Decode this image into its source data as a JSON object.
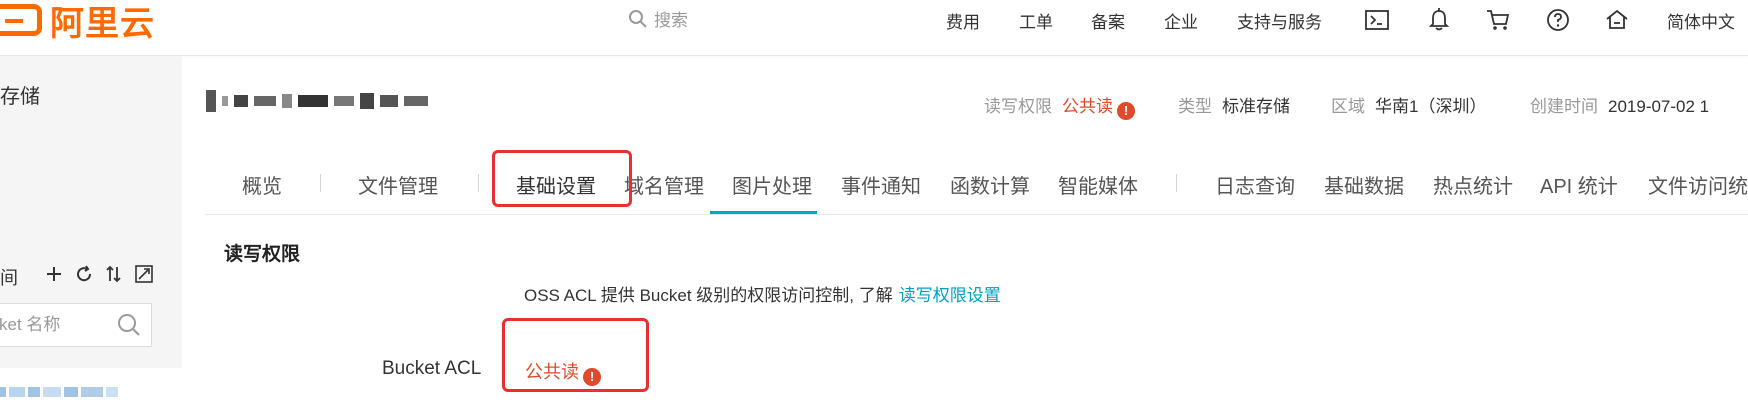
{
  "brand": {
    "logo_text": "阿里云",
    "color": "#ff6a00"
  },
  "search": {
    "placeholder": "搜索"
  },
  "topnav": {
    "fees": "费用",
    "tickets": "工单",
    "filing": "备案",
    "enterprise": "企业",
    "support": "支持与服务",
    "language": "简体中文",
    "icons": [
      "terminal-icon",
      "bell-icon",
      "cart-icon",
      "help-icon",
      "home-icon"
    ]
  },
  "sidebar": {
    "title": "存储",
    "list_label": "间",
    "search_placeholder": "ket 名称",
    "tool_icons": [
      "add-icon",
      "refresh-icon",
      "sort-icon",
      "expand-icon"
    ]
  },
  "bucket_meta": {
    "acl_label": "读写权限",
    "acl_value": "公共读",
    "type_label": "类型",
    "type_value": "标准存储",
    "region_label": "区域",
    "region_value": "华南1（深圳）",
    "created_label": "创建时间",
    "created_value": "2019-07-02 1"
  },
  "tabs": [
    {
      "label": "概览"
    },
    {
      "label": "文件管理"
    },
    {
      "label": "基础设置",
      "active": true
    },
    {
      "label": "域名管理"
    },
    {
      "label": "图片处理"
    },
    {
      "label": "事件通知"
    },
    {
      "label": "函数计算"
    },
    {
      "label": "智能媒体"
    },
    {
      "label": "日志查询"
    },
    {
      "label": "基础数据"
    },
    {
      "label": "热点统计"
    },
    {
      "label": "API 统计"
    },
    {
      "label": "文件访问统"
    }
  ],
  "content": {
    "section_title": "读写权限",
    "description": "OSS ACL 提供 Bucket 级别的权限访问控制, 了解",
    "description_link": "读写权限设置",
    "acl_field_label": "Bucket ACL",
    "acl_field_value": "公共读"
  },
  "colors": {
    "accent": "#00a8c6",
    "warning": "#e04a2b",
    "highlight": "#e8302e"
  }
}
